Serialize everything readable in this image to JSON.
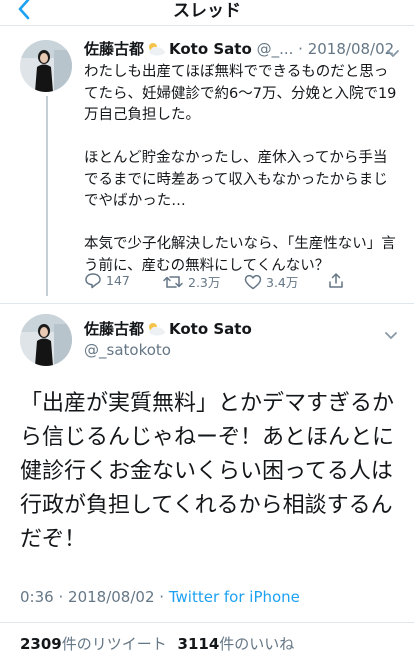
{
  "colors": {
    "accent": "#1da1f2",
    "secondary_text": "#657786",
    "divider": "#e1e8ed"
  },
  "nav": {
    "back_icon": "chevron-left-icon",
    "title": "スレッド"
  },
  "tweet1": {
    "name": "佐藤古都",
    "name_suffix": "Koto Sato",
    "handle": "@_...",
    "dot": "·",
    "date": "2018/08/02",
    "caret_icon": "chevron-down-icon",
    "text": "わたしも出産てほぼ無料でできるものだと思ってたら、妊婦健診で約6〜7万、分娩と入院で19万自己負担した。\n\nほとんど貯金なかったし、産休入ってから手当でるまでに時差あって収入もなかったからまじでやばかった…\n\n本気で少子化解決したいなら、「生産性ない」言う前に、産むの無料にしてくんない？",
    "replies": "147",
    "retweets": "2.3万",
    "likes": "3.4万"
  },
  "tweet2": {
    "name": "佐藤古都",
    "name_suffix": "Koto Sato",
    "handle": "@_satokoto",
    "caret_icon": "chevron-down-icon",
    "text": "「出産が実質無料」とかデマすぎるから信じるんじゃねーぞ！あとほんとに健診行くお金ないくらい困ってる人は行政が負担してくれるから相談するんだぞ！",
    "time": "0:36",
    "dot": "·",
    "date": "2018/08/02",
    "dot2": "·",
    "source": "Twitter for iPhone",
    "retweet_count": "2309",
    "retweet_label": "件のリツイート",
    "like_count": "3114",
    "like_label": "件のいいね"
  }
}
